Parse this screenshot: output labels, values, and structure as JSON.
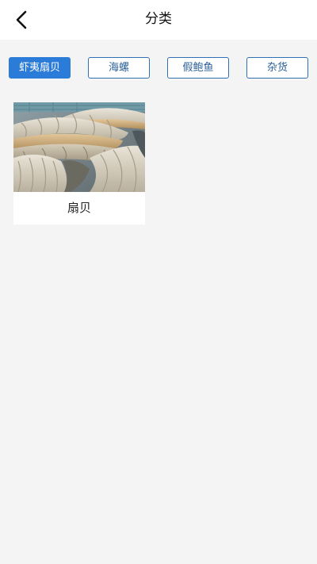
{
  "header": {
    "title": "分类",
    "back_icon": "chevron-left-icon"
  },
  "tabs": [
    {
      "label": "虾夷扇贝",
      "active": true
    },
    {
      "label": "海螺",
      "active": false
    },
    {
      "label": "假鲍鱼",
      "active": false
    },
    {
      "label": "杂货",
      "active": false
    }
  ],
  "products": [
    {
      "name": "扇贝",
      "image": "scallop-photo"
    }
  ],
  "colors": {
    "accent": "#2b7bd8",
    "tab_border": "#2f6fb3",
    "background": "#f4f4f4"
  }
}
